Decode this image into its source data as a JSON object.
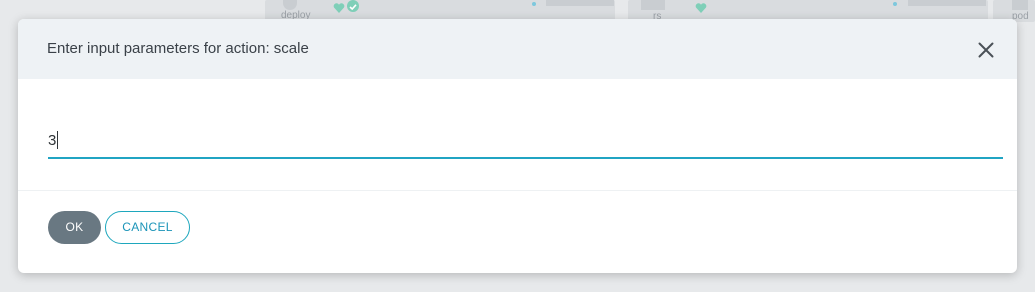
{
  "background": {
    "labels": [
      "deploy",
      "rs",
      "pod"
    ],
    "icons": [
      "deployment-icon",
      "heart-icon",
      "check-icon",
      "heart-icon",
      "pod-icon"
    ]
  },
  "dialog": {
    "title": "Enter input parameters for action: scale",
    "close_icon": "close-icon",
    "input": {
      "value": "3",
      "placeholder": ""
    },
    "ok_label": "OK",
    "cancel_label": "CANCEL"
  },
  "colors": {
    "header_bg": "#eef2f5",
    "accent": "#20a4c3",
    "ok_button_bg": "#697882",
    "cancel_border": "#1ea7bd",
    "backdrop": "#e7e9eb"
  }
}
